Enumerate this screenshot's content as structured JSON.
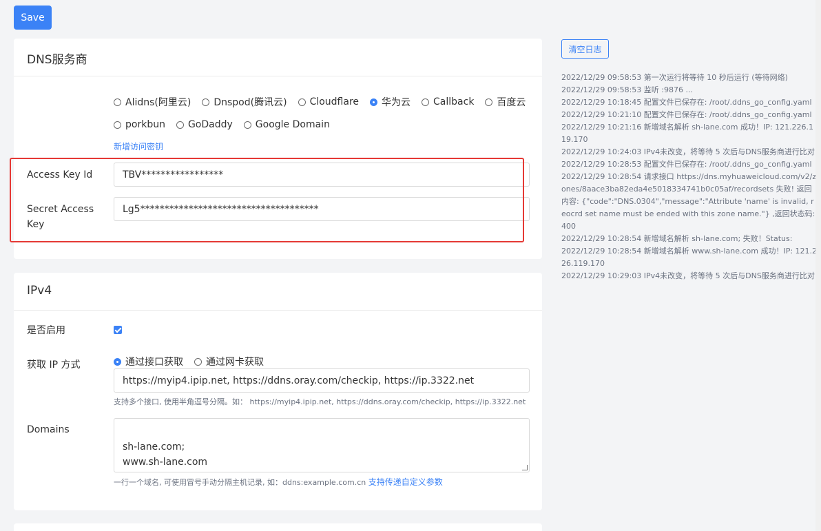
{
  "toolbar": {
    "save_label": "Save"
  },
  "dns_card": {
    "title": "DNS服务商",
    "providers_row1": [
      {
        "label": "Alidns(阿里云)",
        "checked": false
      },
      {
        "label": "Dnspod(腾讯云)",
        "checked": false
      },
      {
        "label": "Cloudflare",
        "checked": false
      },
      {
        "label": "华为云",
        "checked": true
      },
      {
        "label": "Callback",
        "checked": false
      },
      {
        "label": "百度云",
        "checked": false
      }
    ],
    "providers_row2": [
      {
        "label": "porkbun",
        "checked": false
      },
      {
        "label": "GoDaddy",
        "checked": false
      },
      {
        "label": "Google Domain",
        "checked": false
      }
    ],
    "add_key_link": "新增访问密钥",
    "access_key_label": "Access Key Id",
    "access_key_value": "TBV*****************",
    "secret_key_label_line1": "Secret Access",
    "secret_key_label_line2": "Key",
    "secret_key_value": "Lg5*************************************"
  },
  "ipv4_card": {
    "title": "IPv4",
    "enabled_label": "是否启用",
    "enabled": true,
    "method_label": "获取 IP 方式",
    "methods": [
      {
        "label": "通过接口获取",
        "checked": true
      },
      {
        "label": "通过网卡获取",
        "checked": false
      }
    ],
    "url_value": "https://myip4.ipip.net, https://ddns.oray.com/checkip, https://ip.3322.net",
    "url_hint": "支持多个接口, 使用半角逗号分隔。如： https://myip4.ipip.net, https://ddns.oray.com/checkip, https://ip.3322.net",
    "domains_label": "Domains",
    "domains_value": "sh-lane.com;\nwww.sh-lane.com",
    "domains_hint": "一行一个域名, 可使用冒号手动分隔主机记录, 如：ddns:example.com.cn",
    "domains_hint_link": "支持传递自定义参数"
  },
  "log_panel": {
    "clear_label": "清空日志",
    "lines": [
      "2022/12/29 09:58:53 第一次运行将等待 10 秒后运行 (等待网络)",
      "2022/12/29 09:58:53 监听 :9876 ...",
      "2022/12/29 10:18:45 配置文件已保存在: /root/.ddns_go_config.yaml",
      "2022/12/29 10:21:10 配置文件已保存在: /root/.ddns_go_config.yaml",
      "2022/12/29 10:21:16 新增域名解析 sh-lane.com 成功！IP: 121.226.119.170",
      "2022/12/29 10:24:03 IPv4未改变，将等待 5 次后与DNS服务商进行比对",
      "2022/12/29 10:28:53 配置文件已保存在: /root/.ddns_go_config.yaml",
      "2022/12/29 10:28:54 请求接口 https://dns.myhuaweicloud.com/v2/zones/8aace3ba82eda4e5018334741b0c05af/recordsets 失败! 返回内容: {\"code\":\"DNS.0304\",\"message\":\"Attribute 'name' is invalid, reocrd set name must be ended with this zone name.\"} ,返回状态码: 400",
      "2022/12/29 10:28:54 新增域名解析 sh-lane.com; 失败！Status:",
      "2022/12/29 10:28:54 新增域名解析 www.sh-lane.com 成功！IP: 121.226.119.170",
      "2022/12/29 10:29:03 IPv4未改变，将等待 5 次后与DNS服务商进行比对"
    ]
  }
}
